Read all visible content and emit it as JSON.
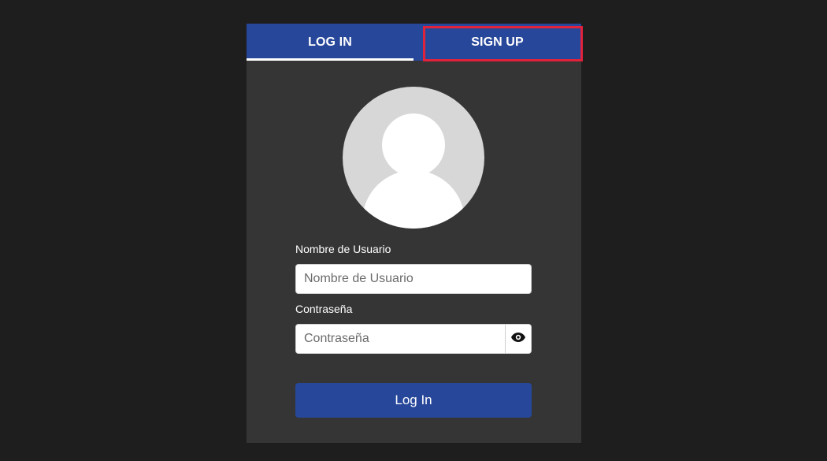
{
  "tabs": {
    "login_label": "LOG IN",
    "signup_label": "SIGN UP",
    "active": "login"
  },
  "form": {
    "username_label": "Nombre de Usuario",
    "username_placeholder": "Nombre de Usuario",
    "username_value": "",
    "password_label": "Contraseña",
    "password_placeholder": "Contraseña",
    "password_value": "",
    "submit_label": "Log In"
  },
  "icons": {
    "avatar": "user-avatar-icon",
    "password_toggle": "eye-icon"
  },
  "colors": {
    "background": "#1e1e1e",
    "card": "#353535",
    "brand_blue": "#27479a",
    "highlight": "#e0223b",
    "avatar_bg": "#d7d7d7"
  }
}
